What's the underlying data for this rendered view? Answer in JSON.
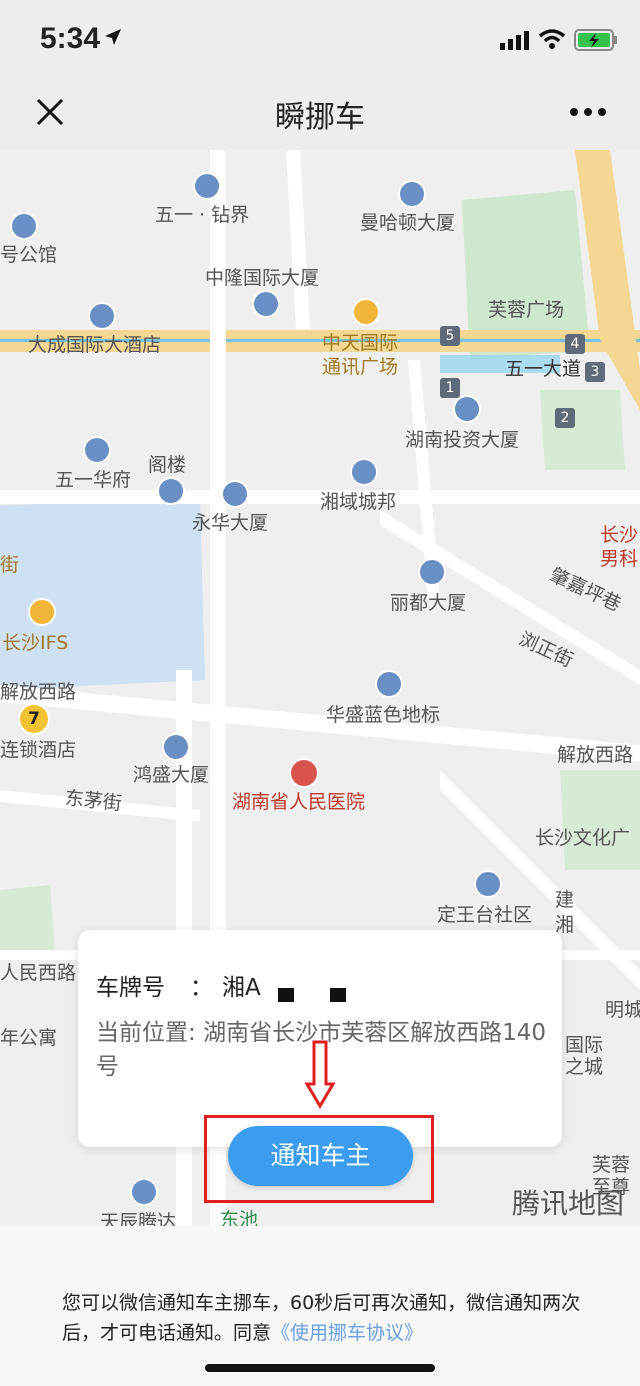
{
  "status": {
    "time": "5:34"
  },
  "nav": {
    "title": "瞬挪车"
  },
  "map": {
    "labels": {
      "wuyi_zuanjie": "五一 · 钻界",
      "manhattan": "曼哈顿大厦",
      "hao_gongguan": "号公馆",
      "zhonglong": "中隆国际大厦",
      "furong_square": "芙蓉广场",
      "dacheng": "大成国际大酒店",
      "zhongtian": "中天国际",
      "tongxun": "通讯广场",
      "wuyi_dadao": "五一大道",
      "hunan_touzi": "湖南投资大厦",
      "wuyi_huafu": "五一华府",
      "gelou": "阁楼",
      "xiangyu": "湘域城邦",
      "yonghua": "永华大厦",
      "changsha_nanke_1": "长沙",
      "changsha_nanke_2": "男科",
      "jie": "街",
      "zhaojiaping": "肇嘉坪巷",
      "lidu": "丽都大厦",
      "changsha_ifs": "长沙IFS",
      "liuzheng": "浏正街",
      "jiefang_xilu_left": "解放西路",
      "huasheng": "华盛蓝色地标",
      "liansuo": "连锁酒店",
      "jiefang_xilu_right": "解放西路",
      "hongsheng": "鸿盛大厦",
      "dongmao": "东茅街",
      "hospital": "湖南省人民医院",
      "wenhua": "长沙文化广",
      "dingwangtai": "定王台社区",
      "jian": "建",
      "xiang": "湘",
      "renmin_xilu": "人民西路",
      "mingcheng": "明城",
      "gongyu": "年公寓",
      "guoji": "国际",
      "zhicheng": "之城",
      "furong2": "芙蓉",
      "zhizun": "至尊",
      "tianchen": "天辰腾达",
      "dongchi": "东池"
    },
    "badges": [
      "5",
      "4",
      "3",
      "1",
      "2"
    ],
    "metro": "7",
    "logo_text": "腾讯地图"
  },
  "card": {
    "plate_label": "车牌号",
    "plate_colon": "：",
    "plate_value": "湘A",
    "location_label": "当前位置:",
    "location_value": "湖南省长沙市芙蓉区解放西路140号"
  },
  "notify_button": "通知车主",
  "footer": {
    "text": "您可以微信通知车主挪车，60秒后可再次通知，微信通知两次后，才可电话通知。同意",
    "link": "《使用挪车协议》"
  },
  "colors": {
    "accent": "#3c9df0",
    "highlight_box": "#e02020",
    "link": "#6aa0e0"
  }
}
